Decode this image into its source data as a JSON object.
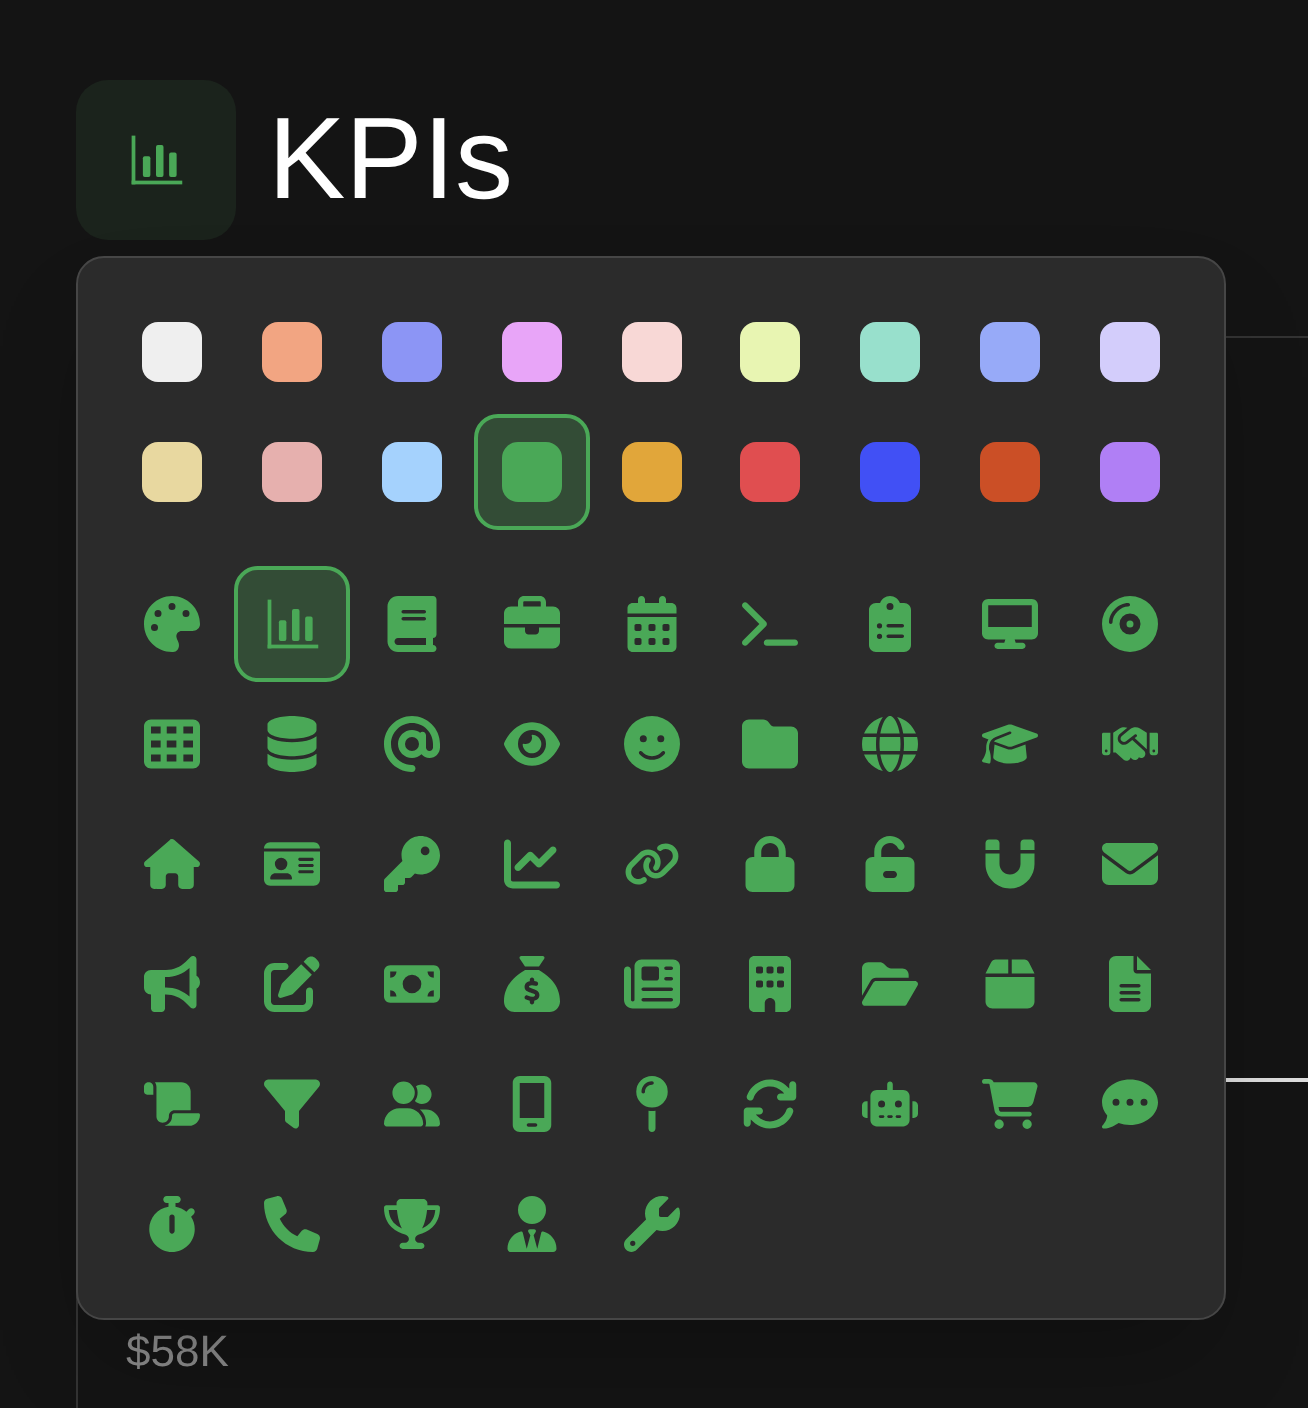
{
  "header": {
    "title": "KPIs"
  },
  "color_swatches": [
    {
      "color": "#efefef",
      "selected": false
    },
    {
      "color": "#f2a582",
      "selected": false
    },
    {
      "color": "#8c95f5",
      "selected": false
    },
    {
      "color": "#e8a5f8",
      "selected": false
    },
    {
      "color": "#f8d8d6",
      "selected": false
    },
    {
      "color": "#e8f5b2",
      "selected": false
    },
    {
      "color": "#98e0cc",
      "selected": false
    },
    {
      "color": "#97aaf8",
      "selected": false
    },
    {
      "color": "#d3cdfb",
      "selected": false
    },
    {
      "color": "#e8d8a0",
      "selected": false
    },
    {
      "color": "#e6b0ae",
      "selected": false
    },
    {
      "color": "#a5d2fd",
      "selected": false
    },
    {
      "color": "#4aa857",
      "selected": true
    },
    {
      "color": "#e1a63a",
      "selected": false
    },
    {
      "color": "#e04e50",
      "selected": false
    },
    {
      "color": "#4150f5",
      "selected": false
    },
    {
      "color": "#cb4f26",
      "selected": false
    },
    {
      "color": "#b07ff5",
      "selected": false
    }
  ],
  "icon_options": [
    {
      "selected": false
    },
    {
      "selected": true
    },
    {
      "selected": false
    },
    {
      "selected": false
    },
    {
      "selected": false
    },
    {
      "selected": false
    },
    {
      "selected": false
    },
    {
      "selected": false
    },
    {
      "selected": false
    },
    {
      "selected": false
    },
    {
      "selected": false
    },
    {
      "selected": false
    },
    {
      "selected": false
    },
    {
      "selected": false
    },
    {
      "selected": false
    },
    {
      "selected": false
    },
    {
      "selected": false
    },
    {
      "selected": false
    },
    {
      "selected": false
    },
    {
      "selected": false
    },
    {
      "selected": false
    },
    {
      "selected": false
    },
    {
      "selected": false
    },
    {
      "selected": false
    },
    {
      "selected": false
    },
    {
      "selected": false
    },
    {
      "selected": false
    },
    {
      "selected": false
    },
    {
      "selected": false
    },
    {
      "selected": false
    },
    {
      "selected": false
    },
    {
      "selected": false
    },
    {
      "selected": false
    },
    {
      "selected": false
    },
    {
      "selected": false
    },
    {
      "selected": false
    },
    {
      "selected": false
    },
    {
      "selected": false
    },
    {
      "selected": false
    },
    {
      "selected": false
    },
    {
      "selected": false
    },
    {
      "selected": false
    },
    {
      "selected": false
    },
    {
      "selected": false
    },
    {
      "selected": false
    },
    {
      "selected": false
    },
    {
      "selected": false
    },
    {
      "selected": false
    },
    {
      "selected": false
    },
    {
      "selected": false
    }
  ],
  "card": {
    "value": "$58K"
  }
}
